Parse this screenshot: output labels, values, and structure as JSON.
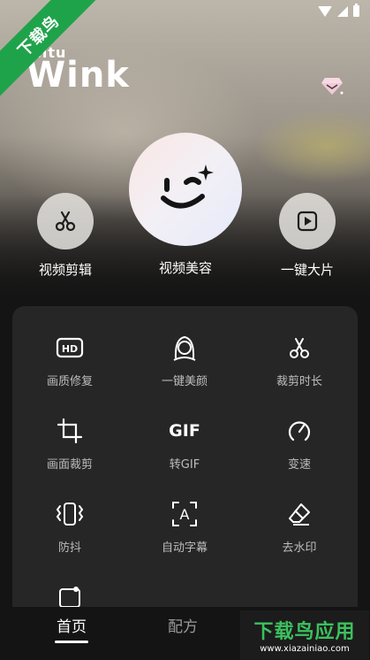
{
  "watermark": {
    "ribbon_text": "下载鸟",
    "badge_title": "下载鸟应用",
    "badge_url": "www.xiazainiao.com"
  },
  "brand": {
    "small": "eitu",
    "name": "Wink"
  },
  "icons": {
    "vip": "diamond-icon"
  },
  "actions": [
    {
      "label": "视频剪辑",
      "icon": "scissors-icon"
    },
    {
      "label": "视频美容",
      "icon": "wink-face-icon"
    },
    {
      "label": "一键大片",
      "icon": "play-square-icon"
    }
  ],
  "tools": [
    {
      "label": "画质修复",
      "icon": "hd-icon"
    },
    {
      "label": "一键美颜",
      "icon": "face-beauty-icon"
    },
    {
      "label": "裁剪时长",
      "icon": "scissors-icon"
    },
    {
      "label": "画面裁剪",
      "icon": "crop-icon"
    },
    {
      "label": "转GIF",
      "icon": "gif-icon",
      "glyph": "GIF"
    },
    {
      "label": "变速",
      "icon": "speed-icon"
    },
    {
      "label": "防抖",
      "icon": "stabilize-icon"
    },
    {
      "label": "自动字幕",
      "icon": "subtitle-icon",
      "glyph": "A"
    },
    {
      "label": "去水印",
      "icon": "eraser-icon"
    }
  ],
  "nav": {
    "home": "首页",
    "formula": "配方"
  },
  "colors": {
    "ribbon": "#1fa34a",
    "panel": "#262626",
    "badge_green": "#3cc15e"
  }
}
